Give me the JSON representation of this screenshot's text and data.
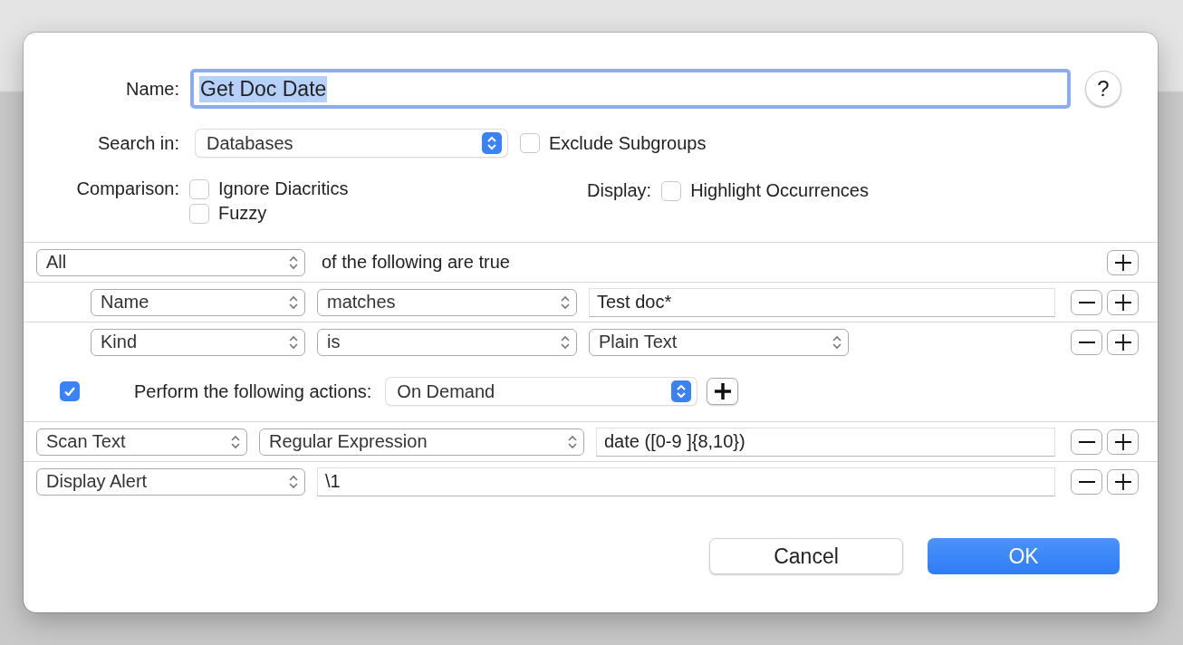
{
  "dialog": {
    "name": {
      "label": "Name:",
      "value": "Get Doc Date",
      "text_selected": true
    },
    "help_button": "?",
    "search_in": {
      "label": "Search in:",
      "value": "Databases",
      "exclude_subgroups": {
        "label": "Exclude Subgroups",
        "checked": false
      }
    },
    "comparison": {
      "label": "Comparison:",
      "options": [
        {
          "label": "Ignore Diacritics",
          "checked": false
        },
        {
          "label": "Fuzzy",
          "checked": false
        }
      ]
    },
    "display": {
      "label": "Display:",
      "options": [
        {
          "label": "Highlight Occurrences",
          "checked": false
        }
      ]
    },
    "criteria": {
      "match": "All",
      "suffix": "of the following are true",
      "rows": [
        {
          "kind": "text",
          "field": "Name",
          "operator": "matches",
          "value": "Test doc*"
        },
        {
          "kind": "popup",
          "field": "Kind",
          "operator": "is",
          "value": "Plain Text"
        }
      ]
    },
    "actions": {
      "enabled": true,
      "label": "Perform the following actions:",
      "trigger": "On Demand",
      "rows": [
        {
          "kind": "option",
          "action": "Scan Text",
          "option": "Regular Expression",
          "value": "date ([0-9 ]{8,10})"
        },
        {
          "kind": "plain",
          "action": "Display Alert",
          "value": "\\1"
        }
      ]
    },
    "buttons": [
      {
        "label": "Cancel",
        "default": false
      },
      {
        "label": "OK",
        "default": true
      }
    ]
  }
}
